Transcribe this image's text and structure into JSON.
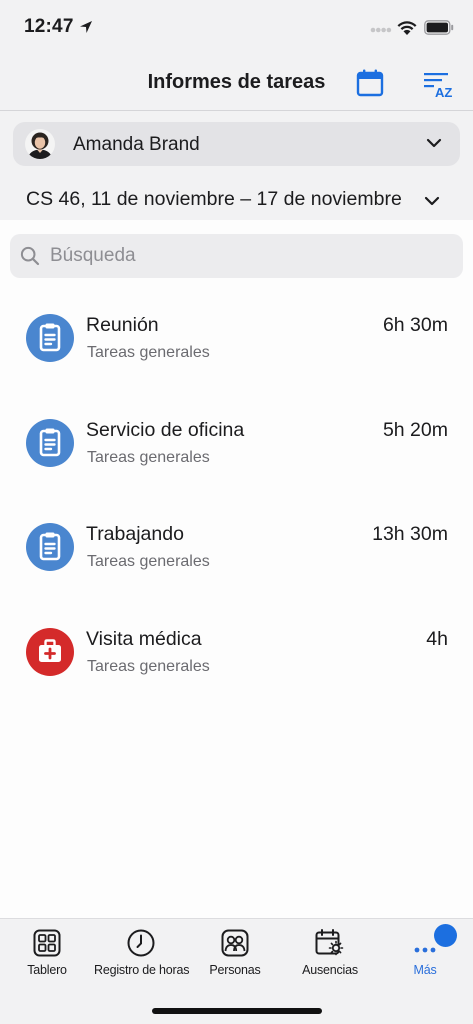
{
  "status": {
    "time": "12:47"
  },
  "header": {
    "title": "Informes de tareas",
    "calendar_icon": "calendar-icon",
    "sort_icon": "sort-az-icon"
  },
  "user": {
    "name": "Amanda Brand"
  },
  "week": {
    "label": "CS 46,  11 de noviembre – 17 de noviembre"
  },
  "search": {
    "placeholder": "Búsqueda",
    "value": ""
  },
  "tasks": [
    {
      "name": "Reunión",
      "category": "Tareas generales",
      "duration": "6h 30m",
      "icon": "clipboard-icon",
      "color": "#4a86cf"
    },
    {
      "name": "Servicio de oficina",
      "category": "Tareas generales",
      "duration": "5h 20m",
      "icon": "clipboard-icon",
      "color": "#4a86cf"
    },
    {
      "name": "Trabajando",
      "category": "Tareas generales",
      "duration": "13h 30m",
      "icon": "clipboard-icon",
      "color": "#4a86cf"
    },
    {
      "name": "Visita médica",
      "category": "Tareas generales",
      "duration": "4h",
      "icon": "medical-kit-icon",
      "color": "#d42a2a"
    }
  ],
  "tabs": [
    {
      "label": "Tablero",
      "icon": "grid-icon"
    },
    {
      "label": "Registro de horas",
      "icon": "clock-icon"
    },
    {
      "label": "Personas",
      "icon": "people-icon"
    },
    {
      "label": "Ausencias",
      "icon": "calendar-sun-icon"
    },
    {
      "label": "Más",
      "icon": "more-dots-icon",
      "active": true
    }
  ],
  "colors": {
    "accent": "#2a6fdb",
    "badge": "#1c6fe0"
  }
}
